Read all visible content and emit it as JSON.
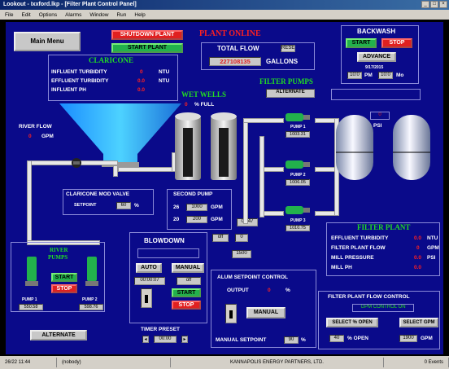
{
  "window": {
    "title": "Lookout - Ixxford.lkp - [Filter Plant Control Panel]"
  },
  "menu": [
    "File",
    "Edit",
    "Options",
    "Alarms",
    "Window",
    "Run",
    "Help"
  ],
  "header": {
    "main_menu": "Main Menu",
    "shutdown": "SHUTDOWN PLANT",
    "start": "START PLANT",
    "plant_status": "PLANT ONLINE",
    "total_flow_label": "TOTAL FLOW",
    "reset": "RESET",
    "total_flow_value": "227108135",
    "gallons": "GALLONS"
  },
  "claricone": {
    "title": "CLARICONE",
    "rows": [
      {
        "label": "INFLUENT TURBIDITY",
        "value": "0",
        "unit": "NTU"
      },
      {
        "label": "EFFLUENT TURBIDITY",
        "value": "0.0",
        "unit": "NTU"
      },
      {
        "label": "INFLUENT PH",
        "value": "0.0",
        "unit": ""
      }
    ]
  },
  "wet_wells": {
    "title": "WET WELLS",
    "value": "0",
    "unit": "% FULL"
  },
  "filter_pumps": {
    "title": "FILTER PUMPS",
    "alternate": "ALTERNATE",
    "pumps": [
      {
        "label": "PUMP 1",
        "value": "1003.31"
      },
      {
        "label": "PUMP 2",
        "value": "1006.05"
      },
      {
        "label": "PUMP 3",
        "value": "1010.75"
      }
    ]
  },
  "river_flow": {
    "label": "RIVER FLOW",
    "value": "0",
    "unit": "GPM"
  },
  "mod_valve": {
    "title": "CLARICONE MOD VALVE",
    "setpoint_label": "SETPOINT",
    "setpoint": "60",
    "unit": "%"
  },
  "second_pump": {
    "title": "SECOND PUMP",
    "rows": [
      {
        "id": "26",
        "value": "1000",
        "unit": "GPM"
      },
      {
        "id": "20",
        "value": "200",
        "unit": "GPM"
      }
    ],
    "time": "04:47"
  },
  "backwash": {
    "title": "BACKWASH",
    "start": "START",
    "stop": "STOP",
    "advance": "ADVANCE",
    "time_label": "9/17/2015",
    "time1": "10:0",
    "pm": "PM",
    "time2": "10:0",
    "mo": "Mo",
    "psi_value": "0",
    "psi": "PSI"
  },
  "river_pumps": {
    "title_line1": "RIVER",
    "title_line2": "PUMPS",
    "start": "START",
    "stop": "STOP",
    "pump1": "PUMP 1",
    "pump2": "PUMP 2",
    "pump1_value": "550.58",
    "pump2_value": "598.76",
    "alternate": "ALTERNATE"
  },
  "blowdown": {
    "title": "BLOWDOWN",
    "auto": "AUTO",
    "manual": "MANUAL",
    "time": "00:00:07",
    "off": "off",
    "start": "START",
    "stop": "STOP",
    "timer_preset": "TIMER PRESET",
    "preset": "00:00",
    "off2": "off",
    "val2": "0",
    "val3": "1500"
  },
  "alum": {
    "title": "ALUM SETPOINT CONTROL",
    "output_label": "OUTPUT",
    "output": "0",
    "unit": "%",
    "manual": "MANUAL",
    "manual_setpoint_label": "MANUAL SETPOINT",
    "manual_setpoint": "90",
    "unit2": "%"
  },
  "filter_plant": {
    "title": "FILTER PLANT",
    "rows": [
      {
        "label": "EFFLUENT TURBIDITY",
        "value": "0.0",
        "unit": "NTU"
      },
      {
        "label": "FILTER PLANT FLOW",
        "value": "0",
        "unit": "GPM"
      },
      {
        "label": "MILL PRESSURE",
        "value": "0.0",
        "unit": "PSI"
      },
      {
        "label": "MILL PH",
        "value": "0.0",
        "unit": ""
      }
    ]
  },
  "flow_control": {
    "title": "FILTER PLANT FLOW CONTROL",
    "mode": "GPM CONTROL ON",
    "select_open": "SELECT % OPEN",
    "select_gpm": "SELECT GPM",
    "open_value": "40",
    "open_unit": "% OPEN",
    "gpm_value": "1900",
    "gpm_unit": "GPM"
  },
  "status": {
    "time": "26/22 11:44",
    "user": "(nobody)",
    "company": "KANNAPOLIS ENERGY PARTNERS, LTD.",
    "alarms": "0 Events"
  },
  "colors": {
    "background": "#0a0a8a",
    "alarm_red": "#e02020",
    "run_green": "#22b14c",
    "title_green": "#22dd22"
  }
}
